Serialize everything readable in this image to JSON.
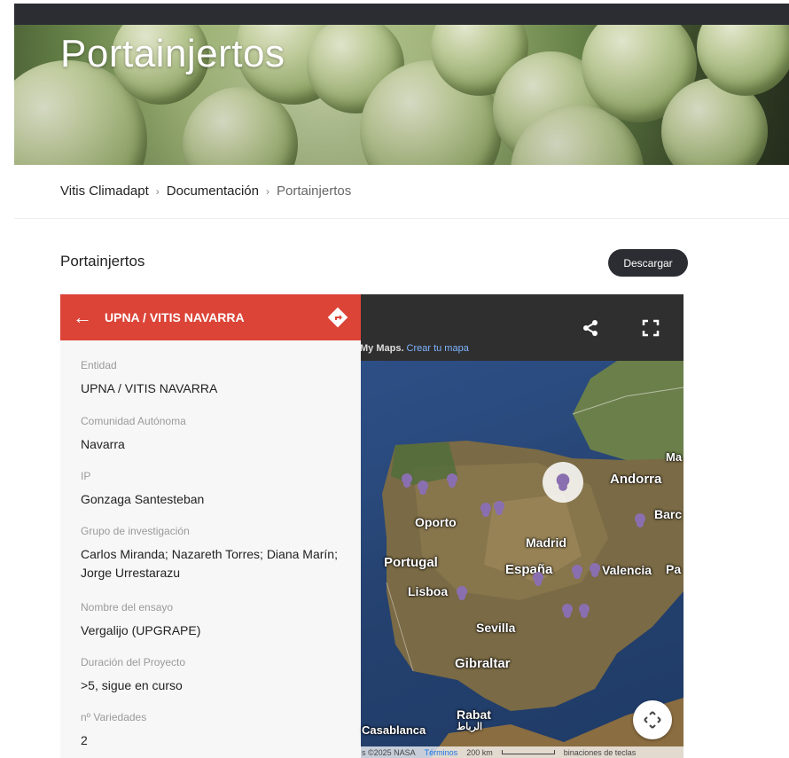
{
  "hero": {
    "title": "Portainjertos"
  },
  "breadcrumb": {
    "items": [
      "Vitis Climadapt",
      "Documentación",
      "Portainjertos"
    ],
    "separator": "›"
  },
  "section": {
    "title": "Portainjertos",
    "download_label": "Descargar"
  },
  "map": {
    "mymaps_text": "My Maps.",
    "create_link": "Crear tu mapa",
    "share_icon": "share-icon",
    "fullscreen_icon": "fullscreen-icon",
    "panel": {
      "title": "UPNA / VITIS NAVARRA",
      "accent": "#db4437",
      "fields": [
        {
          "label": "Entidad",
          "value": "UPNA / VITIS NAVARRA"
        },
        {
          "label": "Comunidad Autónoma",
          "value": "Navarra"
        },
        {
          "label": "IP",
          "value": "Gonzaga Santesteban"
        },
        {
          "label": "Grupo de investigación",
          "value": "Carlos Miranda; Nazareth Torres; Diana Marín; Jorge Urrestarazu"
        },
        {
          "label": "Nombre del ensayo",
          "value": "Vergalijo (UPGRAPE)"
        },
        {
          "label": "Duración del Proyecto",
          "value": ">5, sigue en curso"
        },
        {
          "label": "nº Variedades",
          "value": "2"
        }
      ]
    },
    "labels": {
      "andorra": "Andorra",
      "barc": "Barc",
      "oporto": "Oporto",
      "madrid": "Madrid",
      "portugal": "Portugal",
      "espana": "España",
      "valencia": "Valencia",
      "pa": "Pa",
      "lisboa": "Lisboa",
      "sevilla": "Sevilla",
      "gibraltar": "Gibraltar",
      "rabat": "Rabat",
      "rabat_ar": "الرباط",
      "casablanca": "Casablanca",
      "ma": "Ma"
    },
    "footer": {
      "attribution": "s ©2025 NASA",
      "terms": "Términos",
      "scale": "200 km",
      "shortcuts": "binaciones de teclas"
    }
  }
}
